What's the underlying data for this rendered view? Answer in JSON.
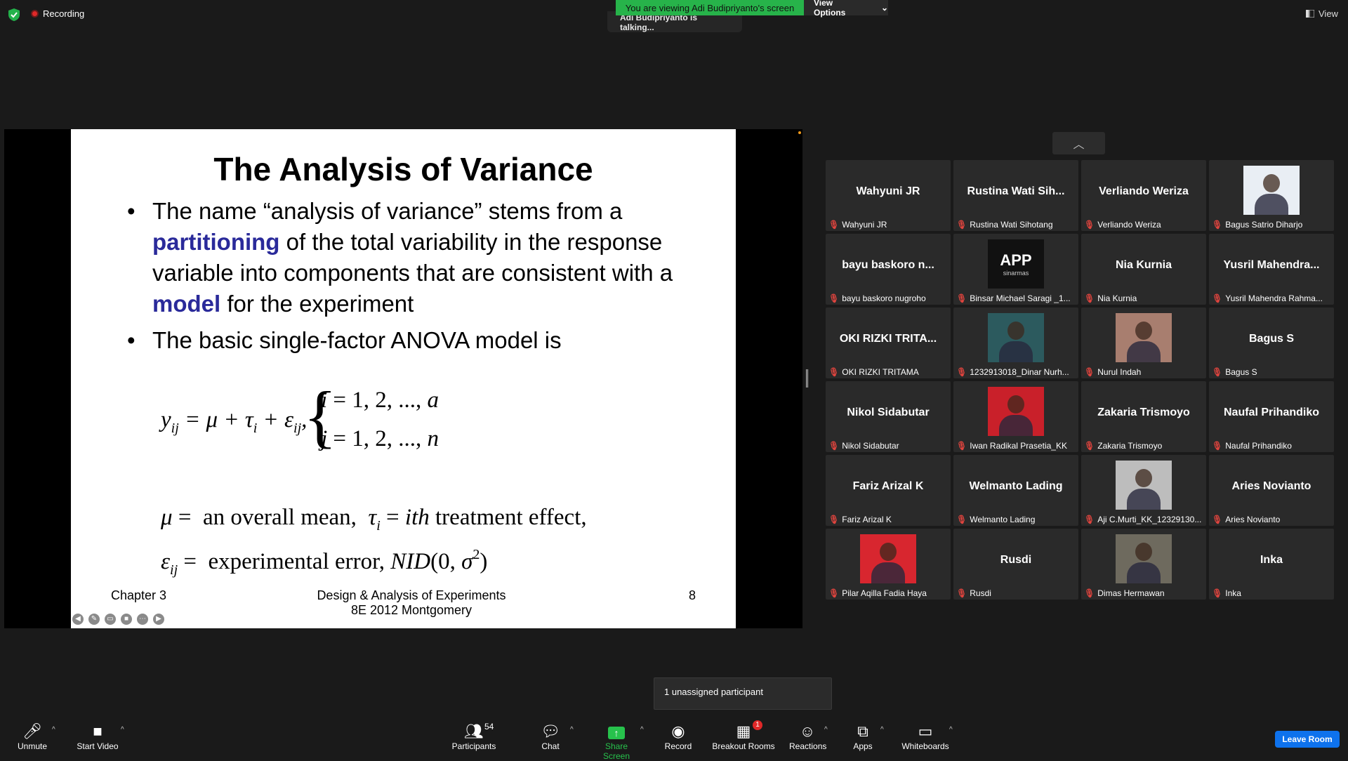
{
  "topbar": {
    "recording_label": "Recording",
    "viewing_banner": "You are viewing Adi Budipriyanto's screen",
    "view_options": "View Options",
    "talking": "Adi Budipriyanto is talking...",
    "view_label": "View"
  },
  "slide": {
    "title": "The Analysis of Variance",
    "bullet1_part1": "The name “analysis of variance” stems from a ",
    "bullet1_hl1": "partitioning",
    "bullet1_part2": " of the total variability in the response variable into components that are consistent with a ",
    "bullet1_hl2": "model",
    "bullet1_part3": " for the experiment",
    "bullet2": "The basic single-factor ANOVA model is",
    "footer_left": "Chapter 3",
    "footer_center_1": "Design & Analysis of Experiments",
    "footer_center_2": "8E 2012 Montgomery",
    "footer_right": "8"
  },
  "gallery": {
    "tiles": [
      {
        "big": "Wahyuni JR",
        "label": "Wahyuni JR"
      },
      {
        "big": "Rustina  Wati Sih...",
        "label": "Rustina Wati Sihotang"
      },
      {
        "big": "Verliando Weriza",
        "label": "Verliando Weriza"
      },
      {
        "big": "",
        "label": "Bagus Satrio Diharjo",
        "photo": "person-photo"
      },
      {
        "big": "bayu baskoro n...",
        "label": "bayu baskoro nugroho"
      },
      {
        "big": "",
        "label": "Binsar Michael Saragi _1...",
        "photo": "app-logo",
        "logo_text": "APP",
        "logo_sub": "sinarmas"
      },
      {
        "big": "Nia Kurnia",
        "label": "Nia Kurnia"
      },
      {
        "big": "Yusril  Mahendra...",
        "label": "Yusril Mahendra Rahma..."
      },
      {
        "big": "OKI RIZKI TRITA...",
        "label": "OKI RIZKI TRITAMA"
      },
      {
        "big": "",
        "label": "1232913018_Dinar Nurh...",
        "photo": "object-photo"
      },
      {
        "big": "",
        "label": "Nurul Indah",
        "photo": "people-photo"
      },
      {
        "big": "Bagus S",
        "label": "Bagus S"
      },
      {
        "big": "Nikol Sidabutar",
        "label": "Nikol Sidabutar"
      },
      {
        "big": "",
        "label": "Iwan Radikal Prasetia_KK",
        "photo": "red-bg-photo"
      },
      {
        "big": "Zakaria Trismoyo",
        "label": "Zakaria Trismoyo"
      },
      {
        "big": "Naufal Prihandiko",
        "label": "Naufal Prihandiko"
      },
      {
        "big": "Fariz Arizal K",
        "label": "Fariz Arizal K"
      },
      {
        "big": "Welmanto Lading",
        "label": "Welmanto Lading"
      },
      {
        "big": "",
        "label": "Aji C.Murti_KK_12329130...",
        "photo": "outdoor-photo"
      },
      {
        "big": "Aries Novianto",
        "label": "Aries Novianto"
      },
      {
        "big": "",
        "label": "Pilar Aqilla Fadia Haya",
        "photo": "red-bg-photo-hijab"
      },
      {
        "big": "Rusdi",
        "label": "Rusdi"
      },
      {
        "big": "",
        "label": "Dimas Hermawan",
        "photo": "forest-photo"
      },
      {
        "big": "Inka",
        "label": "Inka"
      }
    ]
  },
  "toolbar": {
    "unmute": "Unmute",
    "start_video": "Start Video",
    "participants": "Participants",
    "participants_count": "54",
    "chat": "Chat",
    "share_screen": "Share Screen",
    "record": "Record",
    "breakout_rooms": "Breakout Rooms",
    "breakout_badge": "1",
    "reactions": "Reactions",
    "apps": "Apps",
    "whiteboards": "Whiteboards",
    "leave_room": "Leave Room",
    "tooltip": "1 unassigned participant"
  },
  "colors": {
    "share_green": "#27b34a",
    "leave_blue": "#0e72ed",
    "mic_off_red": "#e0443e",
    "highlight_blue": "#2a2a9a"
  }
}
